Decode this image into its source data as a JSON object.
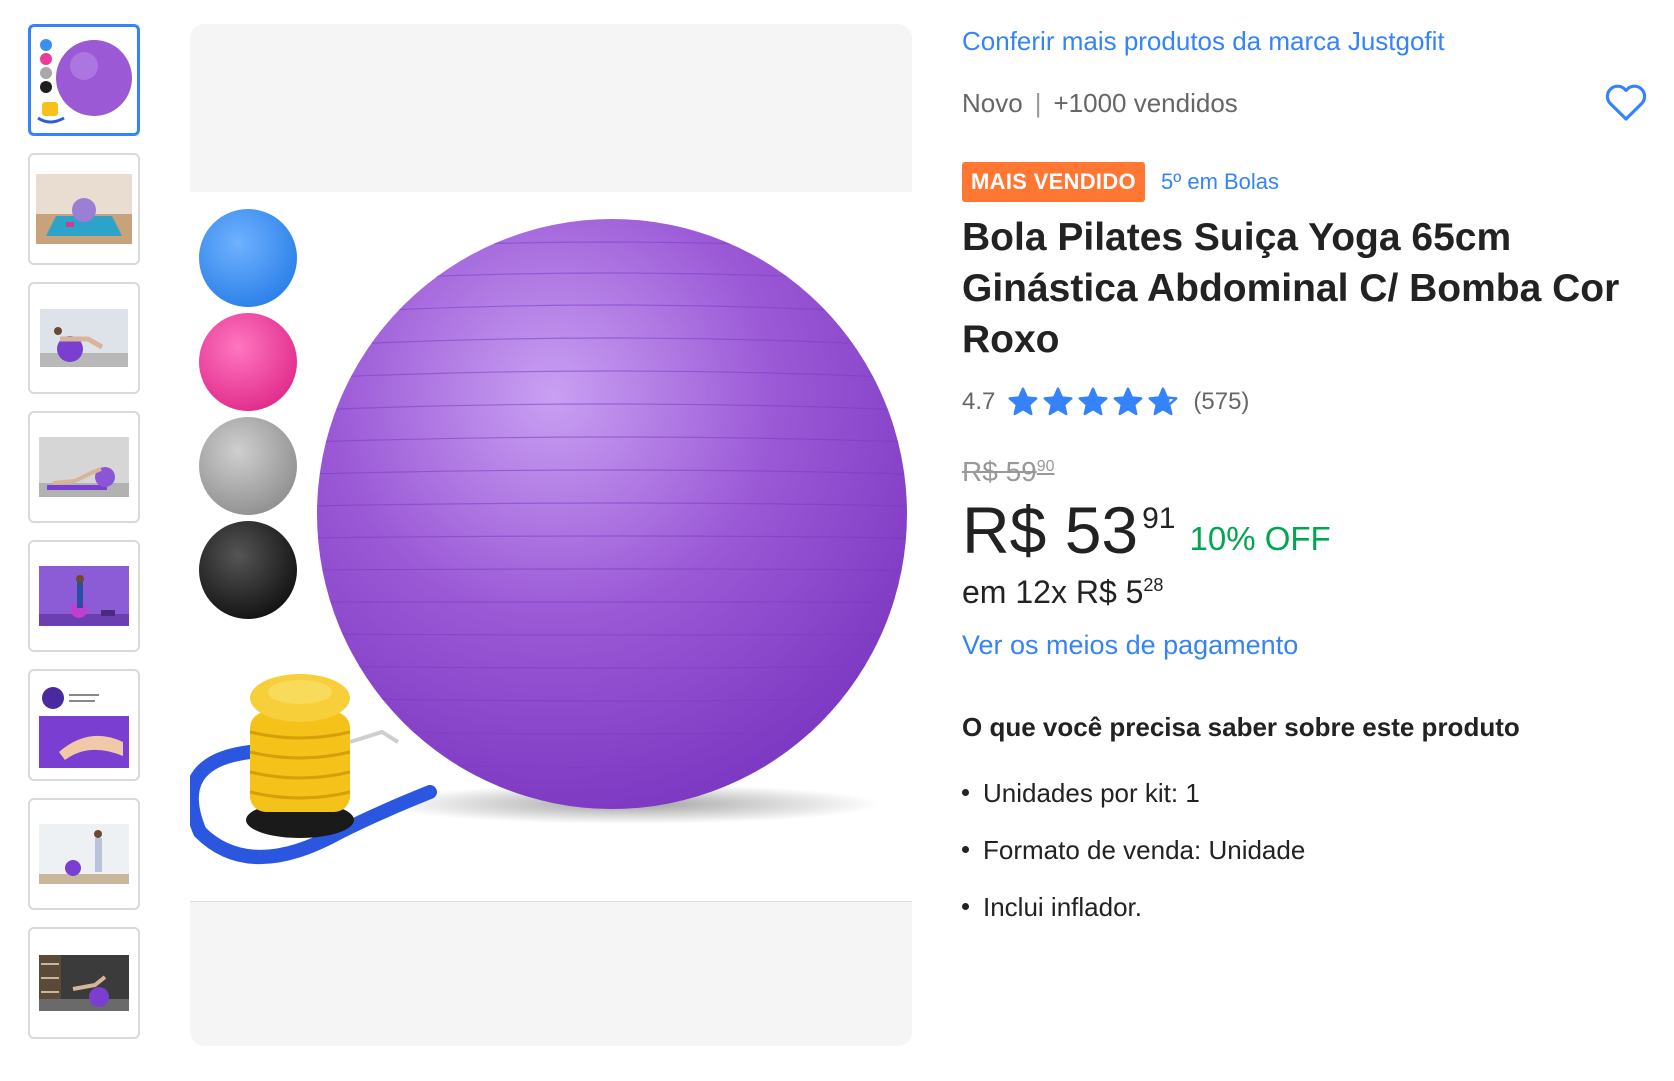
{
  "thumbnails": [
    {
      "name": "thumb-ball-variants",
      "alt": "ball-and-colors-icon"
    },
    {
      "name": "thumb-ball-mat",
      "alt": "ball-on-mat-icon"
    },
    {
      "name": "thumb-woman-exercise-1",
      "alt": "woman-exercise-icon"
    },
    {
      "name": "thumb-woman-exercise-2",
      "alt": "woman-exercise-icon"
    },
    {
      "name": "thumb-woman-purple-bg",
      "alt": "woman-purple-icon"
    },
    {
      "name": "thumb-material-detail",
      "alt": "material-detail-icon"
    },
    {
      "name": "thumb-woman-standing",
      "alt": "woman-standing-icon"
    },
    {
      "name": "thumb-living-room",
      "alt": "living-room-icon"
    }
  ],
  "product": {
    "brand_link": "Conferir mais produtos da marca Justgofit",
    "condition": "Novo",
    "separator": "|",
    "sold": "+1000 vendidos",
    "badge": "MAIS VENDIDO",
    "rank": "5º em Bolas",
    "title": "Bola Pilates Suiça Yoga 65cm Ginástica Abdominal C/ Bomba Cor Roxo",
    "rating": {
      "score": "4.7",
      "value": 4.7,
      "max": 5,
      "count": "(575)"
    },
    "old_price": {
      "whole": "R$ 59",
      "cents": "90"
    },
    "price": {
      "whole": "R$ 53",
      "cents": "91",
      "discount": "10% OFF"
    },
    "installments": {
      "text": "em 12x R$ 5",
      "cents": "28"
    },
    "payment_link": "Ver os meios de pagamento",
    "section_title": "O que você precisa saber sobre este produto",
    "features": [
      "Unidades por kit: 1",
      "Formato de venda: Unidade",
      "Inclui inflador."
    ]
  },
  "colors": {
    "accent": "#3483fa",
    "badge": "#ff7733",
    "discount": "#00a650",
    "ball_purple": "#9b59d6",
    "ball_blue": "#3b8ff0",
    "ball_pink": "#ec3c9a",
    "ball_gray": "#a8a8a8",
    "ball_black": "#1e1e1e",
    "pump_yellow": "#f5c21a"
  },
  "icons": {
    "favorite": "heart-outline-icon",
    "star_full": "star-icon",
    "star_half": "star-half-icon"
  }
}
